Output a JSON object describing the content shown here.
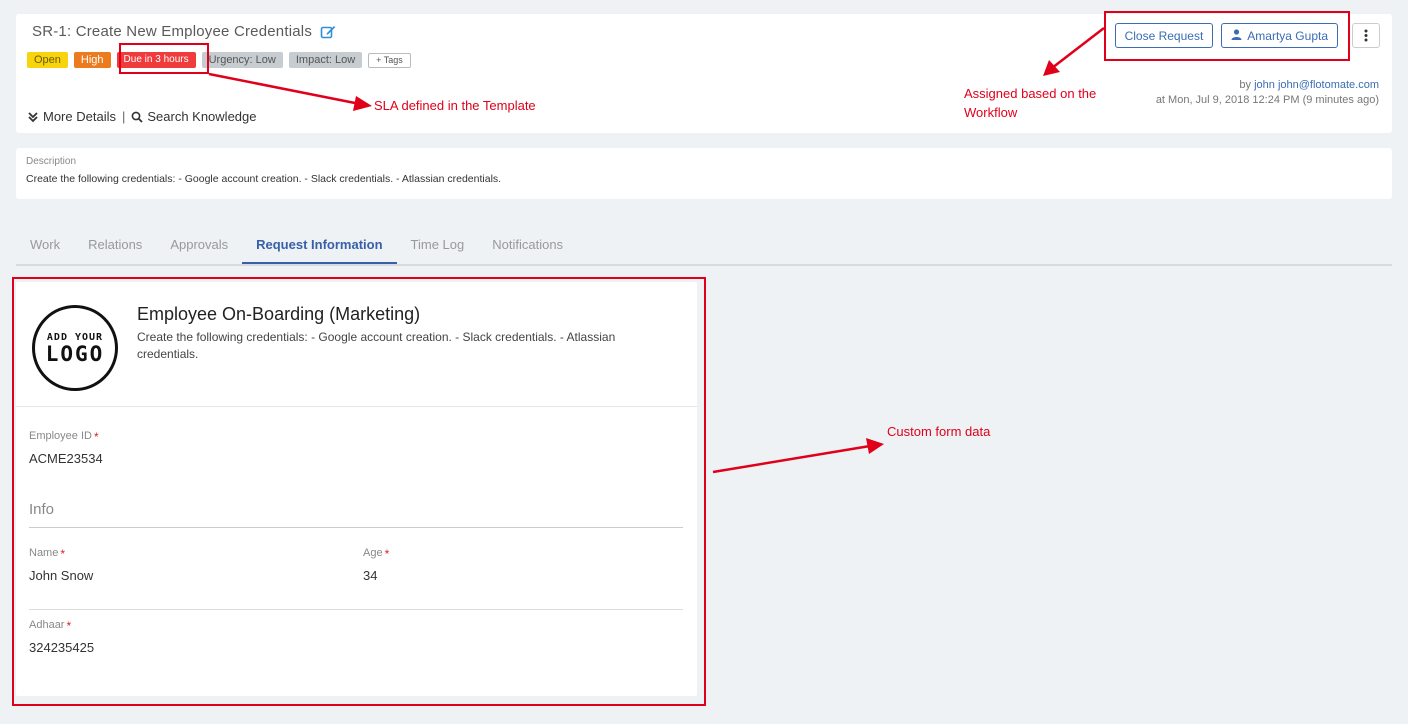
{
  "request": {
    "title": "SR-1: Create New Employee Credentials",
    "badges": {
      "status": "Open",
      "priority": "High",
      "due": "Due in 3 hours",
      "urgency": "Urgency: Low",
      "impact": "Impact: Low",
      "tags": "+ Tags"
    },
    "more_details": "More Details",
    "separator": "|",
    "search_knowledge": "Search Knowledge",
    "close_button": "Close Request",
    "assignee_button": "Amartya Gupta",
    "meta": {
      "by": "by",
      "author": "john",
      "email": "john@flotomate.com",
      "time": "at Mon, Jul 9, 2018 12:24 PM (9 minutes ago)"
    }
  },
  "description": {
    "label": "Description",
    "text": "Create the following credentials: - Google account creation. - Slack credentials. - Atlassian credentials."
  },
  "tabs": [
    "Work",
    "Relations",
    "Approvals",
    "Request Information",
    "Time Log",
    "Notifications"
  ],
  "active_tab": "Request Information",
  "form": {
    "logo_line1": "ADD YOUR",
    "logo_line2": "LOGO",
    "title": "Employee On-Boarding (Marketing)",
    "subtitle": "Create the following credentials: - Google account creation. - Slack credentials. - Atlassian credentials.",
    "employee_id": {
      "label": "Employee ID",
      "value": "ACME23534"
    },
    "section_title": "Info",
    "name": {
      "label": "Name",
      "value": "John Snow"
    },
    "age": {
      "label": "Age",
      "value": "34"
    },
    "adhaar": {
      "label": "Adhaar",
      "value": "324235425"
    },
    "required_mark": "*"
  },
  "annotations": {
    "sla": "SLA defined in the Template",
    "assigned_line1": "Assigned based on the",
    "assigned_line2": "Workflow",
    "custom": "Custom form data"
  },
  "colors": {
    "annotation": "#e0001a",
    "accent": "#3760a8",
    "open": "#f7d40c",
    "high": "#ec7a1f",
    "due": "#ef3b3b"
  }
}
